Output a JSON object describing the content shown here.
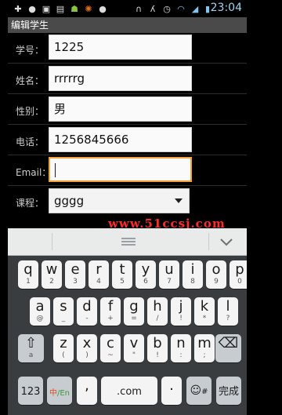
{
  "status_bar": {
    "time": "23:04",
    "icons": [
      "add-icon",
      "globe-icon",
      "image-icon",
      "message-icon",
      "android-icon",
      "sync-icon",
      "alert-icon",
      "headphones-icon",
      "run-icon",
      "alarm-icon",
      "wifi-icon",
      "signal-icon",
      "battery-icon"
    ]
  },
  "title": "编辑学生",
  "form": {
    "rows": [
      {
        "label": "学号：",
        "value": "1225"
      },
      {
        "label": "姓名：",
        "value": "rrrrrg"
      },
      {
        "label": "性别：",
        "value": "男"
      },
      {
        "label": "电话：",
        "value": "1256845666"
      },
      {
        "label": "Email：",
        "value": ""
      },
      {
        "label": "课程：",
        "value": "gggg"
      }
    ]
  },
  "watermark": "www.51ccsj.com",
  "keyboard": {
    "row1": [
      {
        "main": "q",
        "sub": "1"
      },
      {
        "main": "w",
        "sub": "2"
      },
      {
        "main": "e",
        "sub": "3"
      },
      {
        "main": "r",
        "sub": "4"
      },
      {
        "main": "t",
        "sub": "5"
      },
      {
        "main": "y",
        "sub": "6"
      },
      {
        "main": "u",
        "sub": "7"
      },
      {
        "main": "i",
        "sub": "8"
      },
      {
        "main": "o",
        "sub": "9"
      },
      {
        "main": "p",
        "sub": "0"
      }
    ],
    "row2": [
      {
        "main": "a",
        "sub": "@"
      },
      {
        "main": "s",
        "sub": "_"
      },
      {
        "main": "d",
        "sub": "-"
      },
      {
        "main": "f",
        "sub": "+"
      },
      {
        "main": "g",
        "sub": "="
      },
      {
        "main": "h",
        "sub": "/"
      },
      {
        "main": "j",
        "sub": "!"
      },
      {
        "main": "k",
        "sub": "*"
      },
      {
        "main": "l",
        "sub": "?"
      }
    ],
    "row3": [
      {
        "main": "z",
        "sub": "("
      },
      {
        "main": "x",
        "sub": ")"
      },
      {
        "main": "c",
        "sub": "~"
      },
      {
        "main": "v",
        "sub": "\""
      },
      {
        "main": "b",
        "sub": "!"
      },
      {
        "main": "n",
        "sub": ":"
      },
      {
        "main": "m",
        "sub": ";"
      }
    ],
    "shift_sub": "a",
    "numbers": "123",
    "lang_zh": "中",
    "lang_en": "/En",
    "comma": ",",
    "dotcom": ".com",
    "dot": ".",
    "emoji_sub": "#",
    "done": "完成"
  },
  "colors": {
    "focus": "#f2a23a",
    "watermark": "#ff2a2a",
    "clock": "#9fd4f0"
  }
}
